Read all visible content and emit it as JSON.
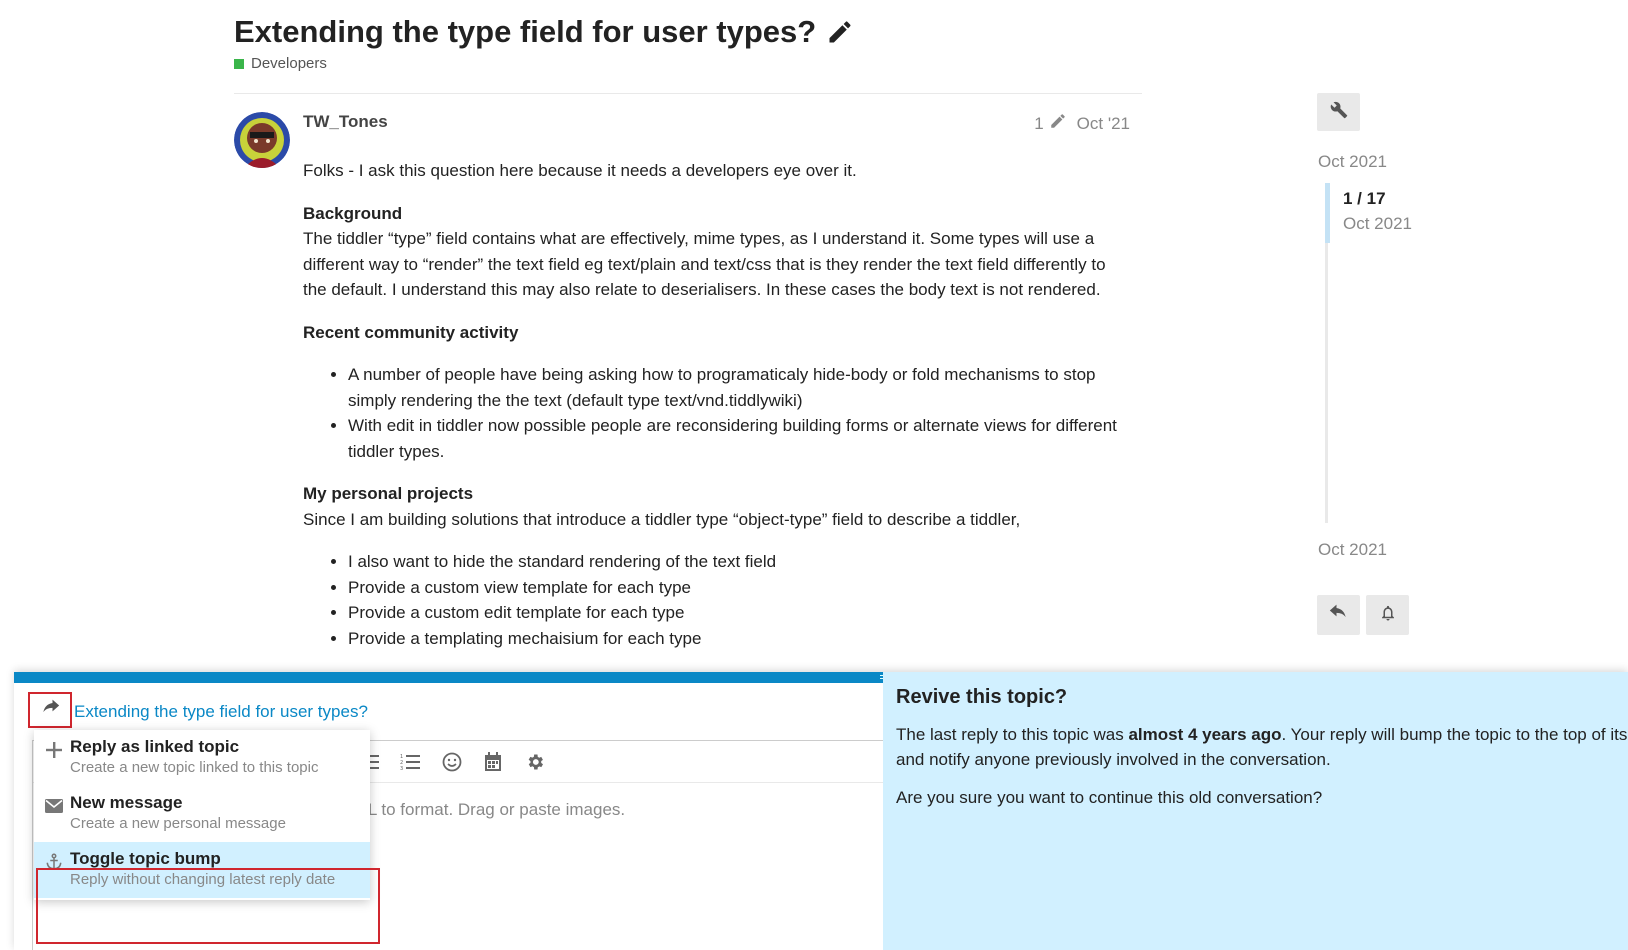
{
  "topic": {
    "title": "Extending the type field for user types?",
    "category": "Developers",
    "category_color": "#3ab54a"
  },
  "post": {
    "username": "TW_Tones",
    "edit_count": "1",
    "date": "Oct '21",
    "intro": "Folks - I ask this question here because it needs a developers eye over it.",
    "background_heading": "Background",
    "background_text": "The tiddler “type” field contains what are effectively, mime types, as I understand it. Some types will use a different way to “render” the text field eg text/plain and text/css that is they render the text field differently to the default. I understand this may also relate to deserialisers. In these cases the body text is not rendered.",
    "activity_heading": "Recent community activity",
    "activity_items": [
      "A number of people have being asking how to programaticaly hide-body or fold mechanisms to stop simply rendering the the text (default type text/vnd.tiddlywiki)",
      "With edit in tiddler now possible people are reconsidering building forms or alternate views for different tiddler types."
    ],
    "projects_heading": "My personal projects",
    "projects_text": "Since I am building solutions that introduce a tiddler type “object-type” field to describe a tiddler,",
    "projects_items": [
      "I also want to hide the standard rendering of the text field",
      "Provide a custom view template for each type",
      "Provide a custom edit template for each type",
      "Provide a templating mechaisium for each type"
    ]
  },
  "timeline": {
    "start_date": "Oct 2021",
    "position": "1 / 17",
    "position_date": "Oct 2021",
    "end_date": "Oct 2021"
  },
  "composer": {
    "reply_to_title": "Extending the type field for user types?",
    "placeholder": "HTML to format. Drag or paste images.",
    "toolbar_icons": [
      "bullet-list-icon",
      "numbered-list-icon",
      "emoji-icon",
      "calendar-icon",
      "gear-icon"
    ],
    "menu": [
      {
        "label": "Reply as linked topic",
        "description": "Create a new topic linked to this topic",
        "icon": "plus-icon"
      },
      {
        "label": "New message",
        "description": "Create a new personal message",
        "icon": "envelope-icon"
      },
      {
        "label": "Toggle topic bump",
        "description": "Reply without changing latest reply date",
        "icon": "anchor-icon"
      }
    ],
    "accent_color": "#0a88c6",
    "highlight_color": "#d0262e"
  },
  "revive": {
    "title": "Revive this topic?",
    "text_before": "The last reply to this topic was ",
    "text_bold": "almost 4 years ago",
    "text_after": ". Your reply will bump the topic to the top of its list",
    "text_line2": "and notify anyone previously involved in the conversation.",
    "question": "Are you sure you want to continue this old conversation?",
    "background_color": "#d1f0ff"
  }
}
